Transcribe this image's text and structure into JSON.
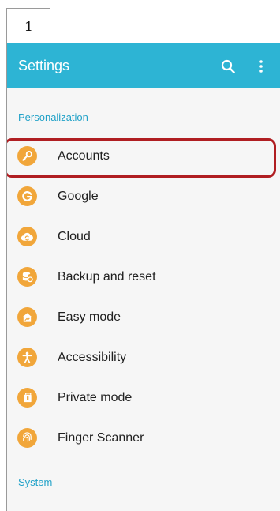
{
  "step_badge": "1",
  "appbar": {
    "title": "Settings",
    "search_icon": "search-icon",
    "more_icon": "more-vertical-icon",
    "color": "#2db4d4"
  },
  "sections": {
    "personalization": "Personalization",
    "system": "System"
  },
  "items": [
    {
      "label": "Accounts",
      "icon": "key-icon"
    },
    {
      "label": "Google",
      "icon": "google-g-icon"
    },
    {
      "label": "Cloud",
      "icon": "cloud-sync-icon"
    },
    {
      "label": "Backup and reset",
      "icon": "backup-icon"
    },
    {
      "label": "Easy mode",
      "icon": "home-icon"
    },
    {
      "label": "Accessibility",
      "icon": "accessibility-icon"
    },
    {
      "label": "Private mode",
      "icon": "private-mode-icon"
    },
    {
      "label": "Finger Scanner",
      "icon": "fingerprint-icon"
    }
  ],
  "colors": {
    "accent_text": "#22a2c8",
    "icon_orange": "#f1a63a",
    "highlight": "#b01e22"
  }
}
